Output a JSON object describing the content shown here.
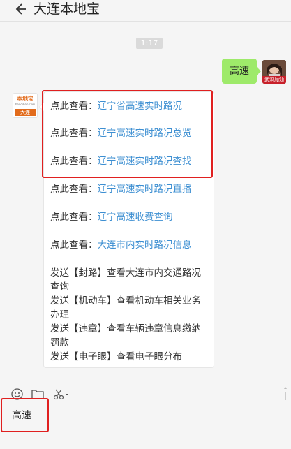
{
  "header": {
    "title": "大连本地宝",
    "back_icon": "arrow-left-icon"
  },
  "chat": {
    "time_badge": "1:17",
    "my_message": "高速",
    "my_avatar_tag": "武汉加油",
    "bot_avatar": {
      "top_text": "本地宝",
      "site_text": "bendibao.com",
      "city_text": "大连"
    },
    "bot_message": {
      "links": [
        {
          "prefix": "点此查看：",
          "link": "辽宁省高速实时路况"
        },
        {
          "prefix": "点此查看：",
          "link": "辽宁高速实时路况总览"
        },
        {
          "prefix": "点此查看：",
          "link": "辽宁高速实时路况查找"
        },
        {
          "prefix": "点此查看：",
          "link": "辽宁高速实时路况直播"
        },
        {
          "prefix": "点此查看：",
          "link": "辽宁高速收费查询"
        },
        {
          "prefix": "点此查看：",
          "link": "大连市内实时路况信息"
        }
      ],
      "send_lines": [
        "发送【封路】查看大连市内交通路况查询",
        "发送【机动车】查看机动车相关业务办理",
        "发送【违章】查看车辆违章信息缴纳罚款",
        "发送【电子眼】查看电子眼分布"
      ]
    }
  },
  "toolbar": {
    "icons": [
      "emoji-icon",
      "folder-icon",
      "scissors-icon"
    ]
  },
  "input": {
    "value": "高速"
  },
  "colors": {
    "link": "#3d8fd2",
    "my_bubble": "#9eea6a",
    "highlight": "#e02020"
  }
}
